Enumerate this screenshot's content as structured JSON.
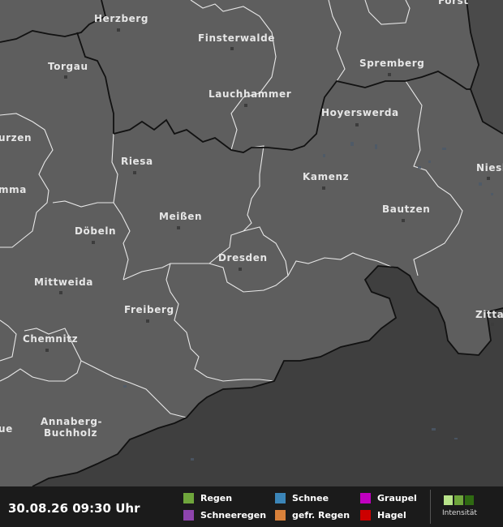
{
  "map": {
    "cities": [
      {
        "id": "herzberg",
        "name": "Herzberg"
      },
      {
        "id": "forst",
        "name": "Forst"
      },
      {
        "id": "finsterwalde",
        "name": "Finsterwalde"
      },
      {
        "id": "torgau",
        "name": "Torgau"
      },
      {
        "id": "spremberg",
        "name": "Spremberg"
      },
      {
        "id": "lauchhammer",
        "name": "Lauchhammer"
      },
      {
        "id": "hoyerswerda",
        "name": "Hoyerswerda"
      },
      {
        "id": "wurzen",
        "name": "urzen"
      },
      {
        "id": "riesa",
        "name": "Riesa"
      },
      {
        "id": "kamenz",
        "name": "Kamenz"
      },
      {
        "id": "niesky",
        "name": "Niesk"
      },
      {
        "id": "grimma",
        "name": "mma"
      },
      {
        "id": "bautzen",
        "name": "Bautzen"
      },
      {
        "id": "meissen",
        "name": "Meißen"
      },
      {
        "id": "doebeln",
        "name": "Döbeln"
      },
      {
        "id": "dresden",
        "name": "Dresden"
      },
      {
        "id": "mittweida",
        "name": "Mittweida"
      },
      {
        "id": "freiberg",
        "name": "Freiberg"
      },
      {
        "id": "zittau",
        "name": "Zitta"
      },
      {
        "id": "chemnitz",
        "name": "Chemnitz"
      },
      {
        "id": "aue",
        "name": "ue"
      },
      {
        "id": "annaberg1",
        "name": "Annaberg-"
      },
      {
        "id": "annaberg2",
        "name": "Buchholz"
      }
    ]
  },
  "legend": {
    "timestamp": "30.08.26 09:30 Uhr",
    "items": [
      {
        "id": "regen",
        "label": "Regen",
        "color": "#6fa63c"
      },
      {
        "id": "schnee",
        "label": "Schnee",
        "color": "#3b85b8"
      },
      {
        "id": "graupel",
        "label": "Graupel",
        "color": "#c000c0"
      },
      {
        "id": "schneeregen",
        "label": "Schneeregen",
        "color": "#8e44ad"
      },
      {
        "id": "gefr_regen",
        "label": "gefr. Regen",
        "color": "#d9813a"
      },
      {
        "id": "hagel",
        "label": "Hagel",
        "color": "#cc0000"
      }
    ],
    "intensity": {
      "label": "Intensität",
      "colors": [
        "#b8e38a",
        "#6fa63c",
        "#2f6a12"
      ]
    }
  }
}
